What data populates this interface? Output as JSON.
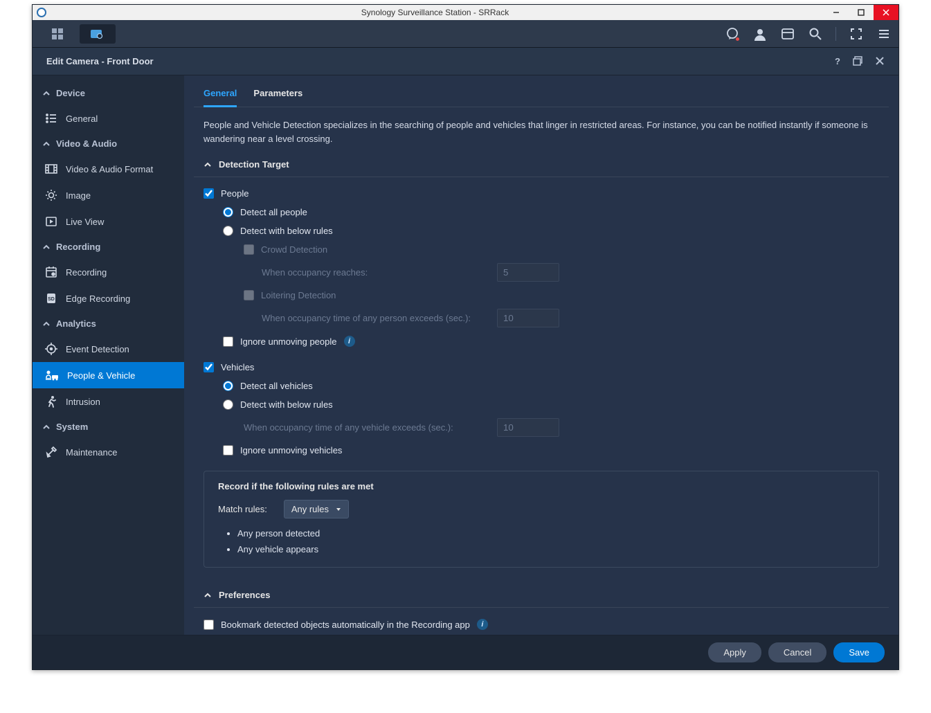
{
  "window_title": "Synology Surveillance Station - SRRack",
  "dialog_title": "Edit Camera - Front Door",
  "sidebar": {
    "sections": [
      {
        "label": "Device",
        "items": [
          {
            "label": "General"
          }
        ]
      },
      {
        "label": "Video & Audio",
        "items": [
          {
            "label": "Video & Audio Format"
          },
          {
            "label": "Image"
          },
          {
            "label": "Live View"
          }
        ]
      },
      {
        "label": "Recording",
        "items": [
          {
            "label": "Recording"
          },
          {
            "label": "Edge Recording"
          }
        ]
      },
      {
        "label": "Analytics",
        "items": [
          {
            "label": "Event Detection"
          },
          {
            "label": "People & Vehicle"
          },
          {
            "label": "Intrusion"
          }
        ]
      },
      {
        "label": "System",
        "items": [
          {
            "label": "Maintenance"
          }
        ]
      }
    ],
    "active": "People & Vehicle"
  },
  "tabs": {
    "general": "General",
    "parameters": "Parameters",
    "active": "General"
  },
  "description": "People and Vehicle Detection specializes in the searching of people and vehicles that linger in restricted areas. For instance, you can be notified instantly if someone is wandering near a level crossing.",
  "headers": {
    "detection_target": "Detection Target",
    "preferences": "Preferences"
  },
  "people": {
    "label": "People",
    "checked": true,
    "detect_all": "Detect all people",
    "detect_rules": "Detect with below rules",
    "mode": "all",
    "crowd": {
      "label": "Crowd Detection",
      "checked": false,
      "occupancy_label": "When occupancy reaches:",
      "occupancy_value": "5"
    },
    "loiter": {
      "label": "Loitering Detection",
      "checked": false,
      "time_label": "When occupancy time of any person exceeds (sec.):",
      "time_value": "10"
    },
    "ignore": {
      "label": "Ignore unmoving people",
      "checked": false
    }
  },
  "vehicles": {
    "label": "Vehicles",
    "checked": true,
    "detect_all": "Detect all vehicles",
    "detect_rules": "Detect with below rules",
    "mode": "all",
    "time_label": "When occupancy time of any vehicle exceeds (sec.):",
    "time_value": "10",
    "ignore": {
      "label": "Ignore unmoving vehicles",
      "checked": false
    }
  },
  "rules": {
    "title": "Record if the following rules are met",
    "match_label": "Match rules:",
    "match_value": "Any rules",
    "list": [
      "Any person detected",
      "Any vehicle appears"
    ]
  },
  "preferences": {
    "bookmark": {
      "label": "Bookmark detected objects automatically in the Recording app",
      "checked": false
    }
  },
  "buttons": {
    "apply": "Apply",
    "cancel": "Cancel",
    "save": "Save"
  }
}
